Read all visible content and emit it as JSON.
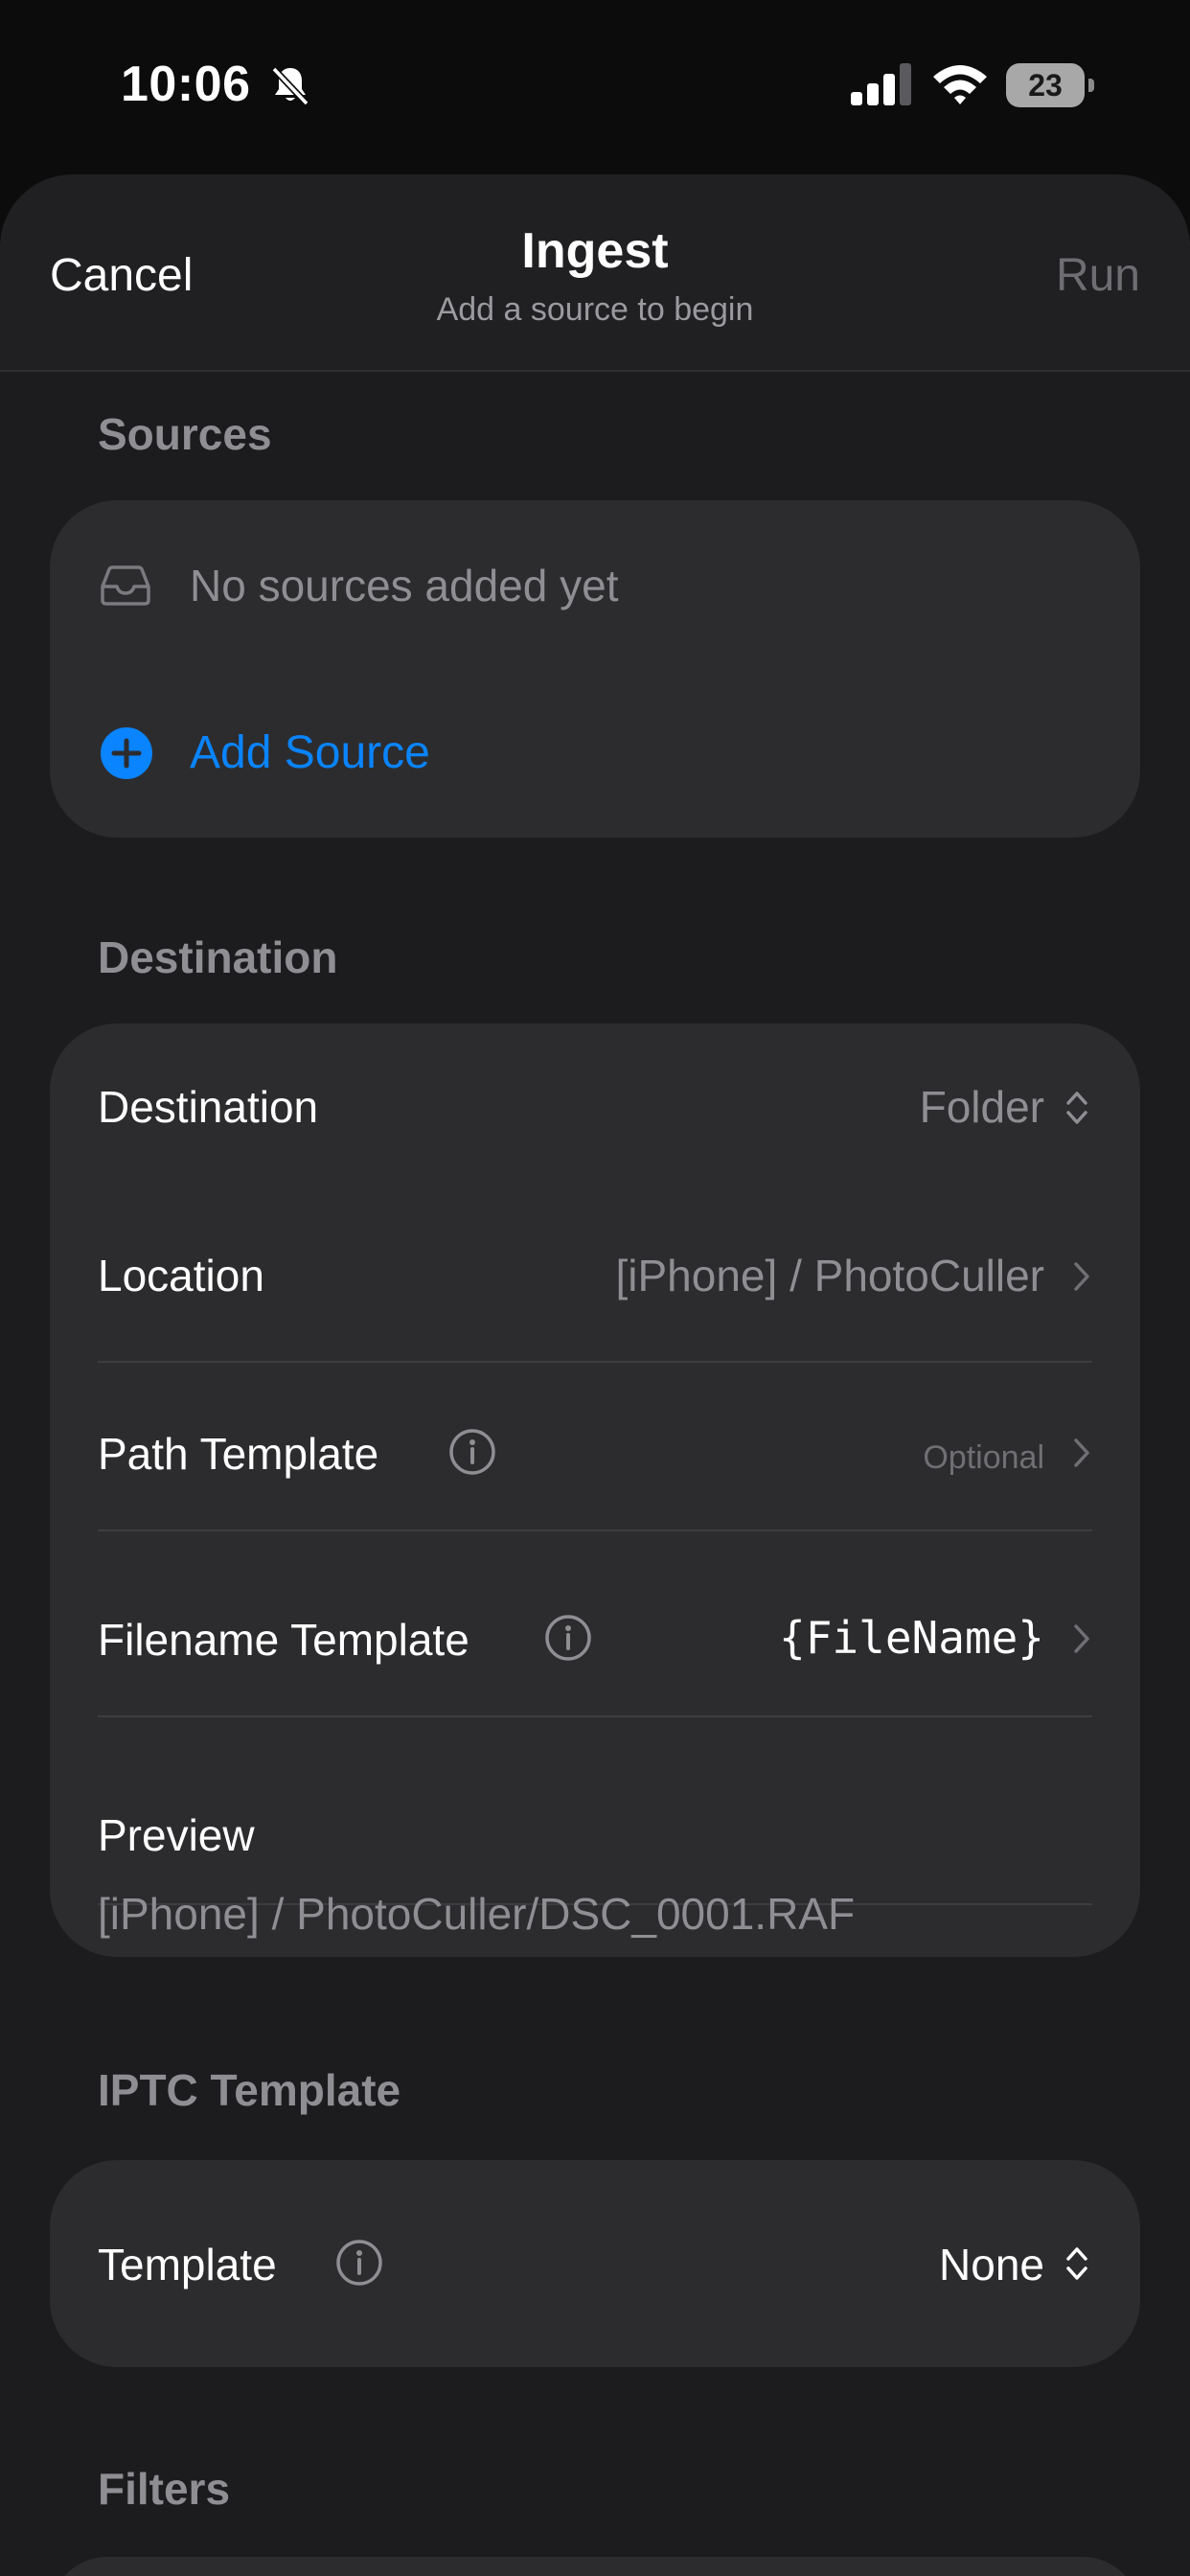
{
  "status_bar": {
    "time": "10:06",
    "battery": "23"
  },
  "nav": {
    "cancel_label": "Cancel",
    "title": "Ingest",
    "subtitle": "Add a source to begin",
    "run_label": "Run"
  },
  "sources": {
    "header": "Sources",
    "empty_text": "No sources added yet",
    "add_label": "Add Source"
  },
  "destination": {
    "header": "Destination",
    "rows": {
      "destination": {
        "label": "Destination",
        "value": "Folder"
      },
      "location": {
        "label": "Location",
        "value": "[iPhone] / PhotoCuller"
      },
      "path_template": {
        "label": "Path Template",
        "value": "Optional"
      },
      "filename_template": {
        "label": "Filename Template",
        "value": "{FileName}"
      }
    },
    "preview": {
      "label": "Preview",
      "value": "[iPhone] / PhotoCuller/DSC_0001.RAF"
    }
  },
  "iptc": {
    "header": "IPTC Template",
    "template": {
      "label": "Template",
      "value": "None"
    }
  },
  "filters": {
    "header": "Filters"
  },
  "colors": {
    "accent": "#0a84ff",
    "background": "#1c1c1e",
    "card": "#2c2c2e",
    "secondary_text": "#8e8e93"
  },
  "icons": {
    "bell": "bell-slash-icon",
    "signal": "cellular-signal-icon",
    "wifi": "wifi-icon",
    "battery": "battery-icon",
    "tray": "tray-icon",
    "add": "plus-circle-icon",
    "info": "info-circle-icon",
    "chevron": "chevron-right-icon",
    "updown": "chevron-up-down-icon"
  }
}
